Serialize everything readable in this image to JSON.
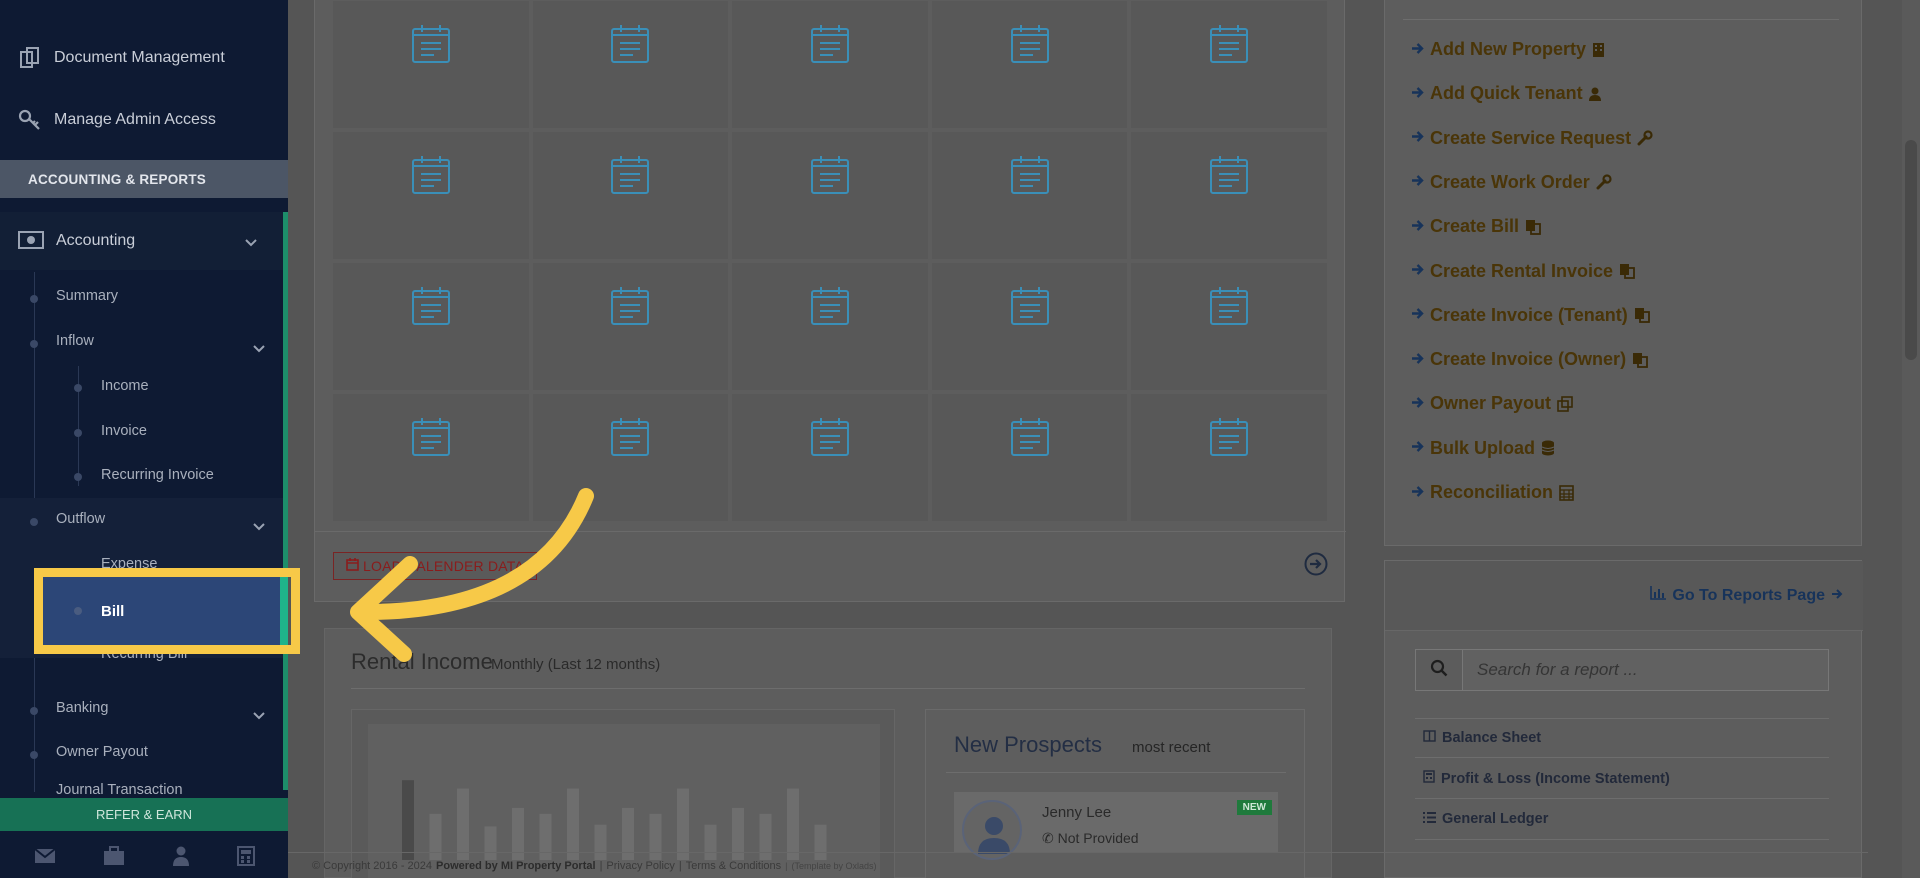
{
  "sidebar": {
    "top_items": [
      {
        "label": "Document Management",
        "icon": "documents-icon"
      },
      {
        "label": "Manage Admin Access",
        "icon": "key-icon"
      }
    ],
    "section_header": "ACCOUNTING & REPORTS",
    "accounting": {
      "label": "Accounting",
      "icon": "money-icon"
    },
    "items": {
      "summary": "Summary",
      "inflow": "Inflow",
      "income": "Income",
      "invoice": "Invoice",
      "recurring_invoice": "Recurring Invoice",
      "outflow": "Outflow",
      "expense": "Expense",
      "bill": "Bill",
      "recurring_bill": "Recurring Bill",
      "banking": "Banking",
      "owner_payout": "Owner Payout",
      "journal_transaction": "Journal Transaction"
    },
    "refer_label": "REFER & EARN",
    "bottom_icons": [
      "mail-icon",
      "briefcase-icon",
      "user-icon",
      "calculator-icon"
    ]
  },
  "calendar": {
    "load_label": "LOAD CALENDER DATA"
  },
  "rental_income": {
    "title": "Rental Income",
    "subtitle": "Monthly (Last 12 months)",
    "bars": [
      0.95,
      0.55,
      0.85,
      0.4,
      0.62,
      0.55,
      0.85,
      0.42,
      0.62,
      0.55,
      0.85,
      0.42,
      0.62,
      0.55,
      0.85,
      0.42
    ]
  },
  "prospects": {
    "title": "New Prospects",
    "subtitle": "most recent",
    "card": {
      "name": "Jenny Lee",
      "phone": "Not Provided",
      "badge": "NEW"
    }
  },
  "quick_links": [
    {
      "label": "Add New Property",
      "icon": "building-icon"
    },
    {
      "label": "Add Quick Tenant",
      "icon": "person-icon"
    },
    {
      "label": "Create Service Request",
      "icon": "wrench-icon"
    },
    {
      "label": "Create Work Order",
      "icon": "wrench-icon"
    },
    {
      "label": "Create Bill",
      "icon": "copy-icon"
    },
    {
      "label": "Create Rental Invoice",
      "icon": "copy-icon"
    },
    {
      "label": "Create Invoice (Tenant)",
      "icon": "copy-icon"
    },
    {
      "label": "Create Invoice (Owner)",
      "icon": "copy-icon"
    },
    {
      "label": "Owner Payout",
      "icon": "clone-icon"
    },
    {
      "label": "Bulk Upload",
      "icon": "database-icon"
    },
    {
      "label": "Reconciliation",
      "icon": "calculator-icon"
    }
  ],
  "reports": {
    "go_label": "Go To Reports Page",
    "search_placeholder": "Search for a report ...",
    "items": [
      {
        "label": "Balance Sheet",
        "icon": "columns-icon"
      },
      {
        "label": "Profit & Loss (Income Statement)",
        "icon": "calculator-icon"
      },
      {
        "label": "General Ledger",
        "icon": "list-icon"
      }
    ]
  },
  "footer": {
    "copyright": "© Copyright 2016 - 2024",
    "powered": "Powered by MI Property Portal",
    "privacy": "Privacy Policy",
    "terms": "Terms & Conditions",
    "template": "(Template by Oxlads)",
    "sep": "|"
  },
  "colors": {
    "highlight": "#f7c948",
    "sidebar_bg": "#0e1a33",
    "active_item": "#2c4677",
    "refer_bg": "#177155"
  }
}
